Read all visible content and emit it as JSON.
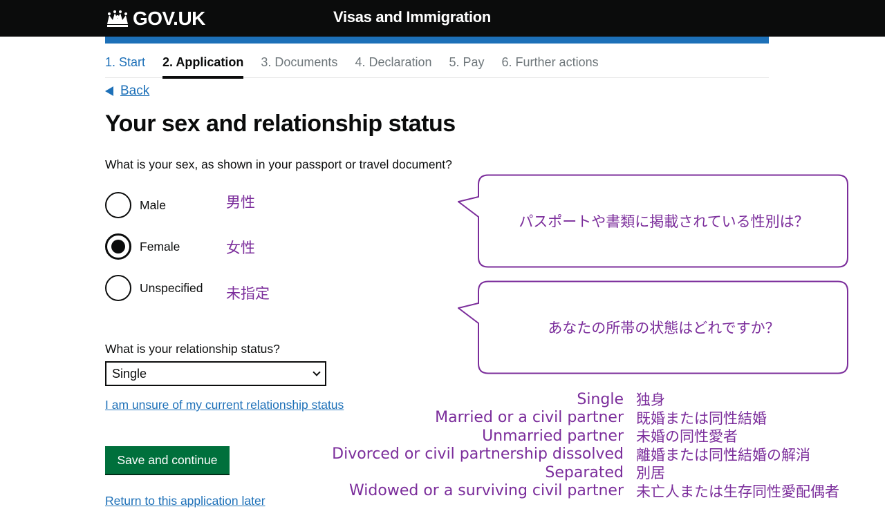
{
  "header": {
    "logo_text": "GOV.UK",
    "service_name": "Visas and Immigration"
  },
  "steps": [
    {
      "label": "1. Start",
      "state": "done"
    },
    {
      "label": "2. Application",
      "state": "current"
    },
    {
      "label": "3. Documents",
      "state": "todo"
    },
    {
      "label": "4. Declaration",
      "state": "todo"
    },
    {
      "label": "5. Pay",
      "state": "todo"
    },
    {
      "label": "6. Further actions",
      "state": "todo"
    }
  ],
  "back_label": "Back",
  "page_title": "Your sex and relationship status",
  "sex_question": "What is your sex, as shown in your passport or travel document?",
  "sex_options": [
    {
      "label": "Male",
      "jp": "男性",
      "checked": false
    },
    {
      "label": "Female",
      "jp": "女性",
      "checked": true
    },
    {
      "label": "Unspecified",
      "jp": "未指定",
      "checked": false
    }
  ],
  "relationship_question": "What is your relationship status?",
  "relationship_select": {
    "value": "Single"
  },
  "unsure_link": "I am unsure of my current relationship status",
  "save_button": "Save and continue",
  "return_link": "Return to this application later",
  "bubbles": {
    "sex_question_jp": "パスポートや書類に掲載されている性別は？",
    "relationship_question_jp": "あなたの所帯の状態はどれですか？"
  },
  "translations": [
    {
      "en": "Single",
      "jp": "独身"
    },
    {
      "en": "Married or a civil partner",
      "jp": "既婚または同性結婚"
    },
    {
      "en": "Unmarried partner",
      "jp": "未婚の同性愛者"
    },
    {
      "en": "Divorced or civil partnership dissolved",
      "jp": "離婚または同性結婚の解消"
    },
    {
      "en": "Separated",
      "jp": "別居"
    },
    {
      "en": "Widowed or a surviving civil partner",
      "jp": "未亡人または生存同性愛配偶者"
    }
  ],
  "colors": {
    "header_bg": "#0b0c0c",
    "brand_blue": "#1d70b8",
    "button_green": "#00703c",
    "annotation_purple": "#7b2d9b"
  }
}
